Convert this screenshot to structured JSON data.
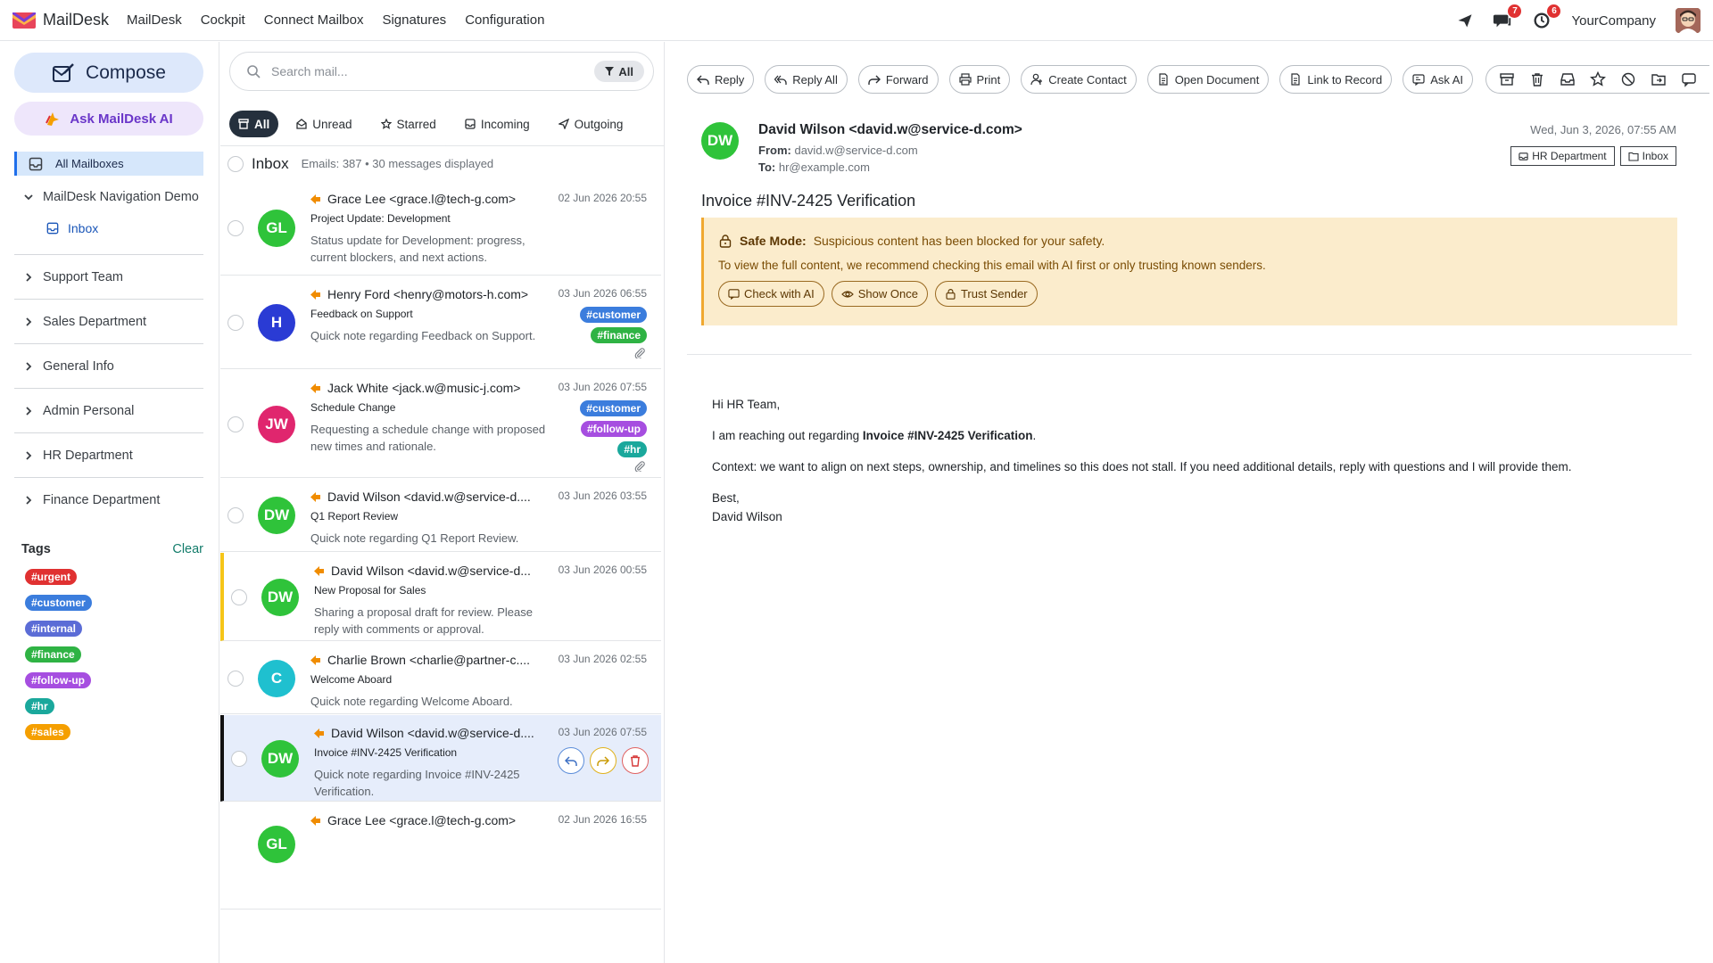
{
  "app": {
    "name": "MailDesk",
    "accent": "#1f6feb"
  },
  "topnav": {
    "items": [
      "MailDesk",
      "Cockpit",
      "Connect Mailbox",
      "Signatures",
      "Configuration"
    ],
    "chat_badge": "7",
    "activity_badge": "6",
    "company": "YourCompany"
  },
  "sidebar": {
    "compose": "Compose",
    "ask_ai": "Ask MailDesk AI",
    "all_mailboxes": "All Mailboxes",
    "nav_demo": "MailDesk Navigation Demo",
    "inbox": "Inbox",
    "mailboxes": [
      "Support Team",
      "Sales Department",
      "General Info",
      "Admin Personal",
      "HR Department",
      "Finance Department"
    ],
    "tags_title": "Tags",
    "tags_clear": "Clear",
    "tags": [
      {
        "label": "#urgent",
        "color": "#e03131"
      },
      {
        "label": "#customer",
        "color": "#3b7ddd"
      },
      {
        "label": "#internal",
        "color": "#5b6cd6"
      },
      {
        "label": "#finance",
        "color": "#2fb344"
      },
      {
        "label": "#follow-up",
        "color": "#a64ee0"
      },
      {
        "label": "#hr",
        "color": "#1aa89c"
      },
      {
        "label": "#sales",
        "color": "#f59f00"
      }
    ]
  },
  "maillist": {
    "search_placeholder": "Search mail...",
    "search_filter": "All",
    "filters": [
      "All",
      "Unread",
      "Starred",
      "Incoming",
      "Outgoing"
    ],
    "folder": "Inbox",
    "count": "Emails: 387 • 30 messages displayed",
    "mails": [
      {
        "initials": "GL",
        "avatar_color": "#2fc33a",
        "from": "Grace Lee <grace.l@tech-g.com>",
        "subject": "Project Update: Development",
        "preview": "Status update for Development: progress, current blockers, and next actions.",
        "date": "02 Jun 2026 20:55"
      },
      {
        "initials": "H",
        "avatar_color": "#2a3bd4",
        "from": "Henry Ford <henry@motors-h.com>",
        "subject": "Feedback on Support",
        "preview": "Quick note regarding Feedback on Support.",
        "date": "03 Jun 2026 06:55",
        "tags": [
          "#customer",
          "#finance"
        ]
      },
      {
        "initials": "JW",
        "avatar_color": "#e0266e",
        "from": "Jack White <jack.w@music-j.com>",
        "subject": "Schedule Change",
        "preview": "Requesting a schedule change with proposed new times and rationale.",
        "date": "03 Jun 2026 07:55",
        "tags": [
          "#customer",
          "#follow-up",
          "#hr"
        ]
      },
      {
        "initials": "DW",
        "avatar_color": "#2fc33a",
        "from": "David Wilson <david.w@service-d....",
        "subject": "Q1 Report Review",
        "preview": "Quick note regarding Q1 Report Review.",
        "date": "03 Jun 2026 03:55"
      },
      {
        "initials": "DW",
        "avatar_color": "#2fc33a",
        "from": "David Wilson <david.w@service-d...",
        "subject": "New Proposal for Sales",
        "preview": "Sharing a proposal draft for review. Please reply with comments or approval.",
        "date": "03 Jun 2026 00:55"
      },
      {
        "initials": "C",
        "avatar_color": "#1fc0cf",
        "from": "Charlie Brown <charlie@partner-c....",
        "subject": "Welcome Aboard",
        "preview": "Quick note regarding Welcome Aboard.",
        "date": "03 Jun 2026 02:55"
      },
      {
        "initials": "DW",
        "avatar_color": "#2fc33a",
        "from": "David Wilson <david.w@service-d....",
        "subject": "Invoice #INV-2425 Verification",
        "preview": "Quick note regarding Invoice #INV-2425 Verification.",
        "date": "03 Jun 2026 07:55"
      },
      {
        "initials": "GL",
        "avatar_color": "#2fc33a",
        "from": "Grace Lee <grace.l@tech-g.com>",
        "subject": "",
        "preview": "",
        "date": "02 Jun 2026 16:55"
      }
    ]
  },
  "reader": {
    "toolbar": [
      "Reply",
      "Reply All",
      "Forward",
      "Print",
      "Create Contact",
      "Open Document",
      "Link to Record",
      "Ask AI"
    ],
    "initials": "DW",
    "from": "David Wilson <david.w@service-d.com>",
    "from_label": "From:",
    "from_addr": "david.w@service-d.com",
    "to_label": "To:",
    "to_addr": "hr@example.com",
    "date": "Wed, Jun 3, 2026, 07:55 AM",
    "chips": [
      "HR Department",
      "Inbox"
    ],
    "subject": "Invoice #INV-2425 Verification",
    "safe_title": "Safe Mode:",
    "safe_msg": "Suspicious content has been blocked for your safety.",
    "safe_line2": "To view the full content, we recommend checking this email with AI first or only trusting known senders.",
    "safe_btns": [
      "Check with AI",
      "Show Once",
      "Trust Sender"
    ],
    "body": {
      "greeting": "Hi HR Team,",
      "line1_pre": "I am reaching out regarding ",
      "line1_bold": "Invoice #INV-2425 Verification",
      "line1_post": ".",
      "line2": "Context: we want to align on next steps, ownership, and timelines so this does not stall. If you need additional details, reply with questions and I will provide them.",
      "signoff": "Best,",
      "name": "David Wilson"
    }
  }
}
